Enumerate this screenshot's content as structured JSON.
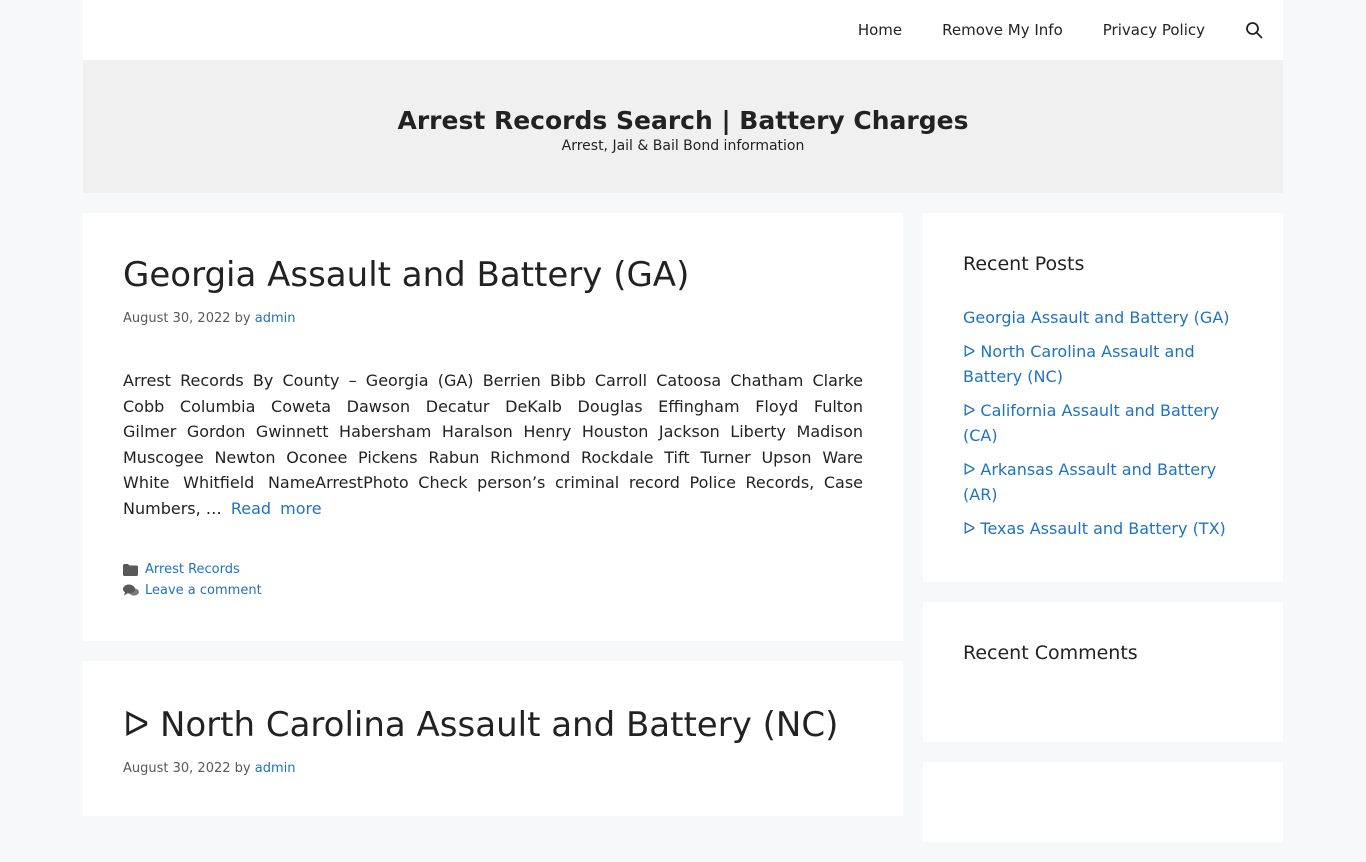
{
  "nav": {
    "items": [
      "Home",
      "Remove My Info",
      "Privacy Policy"
    ],
    "search_icon": "search-icon"
  },
  "header": {
    "title": "Arrest Records Search | Battery Charges",
    "description": "Arrest, Jail & Bail Bond information"
  },
  "posts": [
    {
      "title": "Georgia Assault and Battery (GA)",
      "date": "August 30, 2022",
      "by": "by",
      "author": "admin",
      "counties": "Arrest Records By County – Georgia (GA) Berrien Bibb Carroll Catoosa Chatham Clarke Cobb Columbia Coweta Dawson Decatur DeKalb Douglas Effingham Floyd Fulton Gilmer Gordon Gwinnett Habersham Haralson Henry Houston Jackson Liberty Madison Muscogee Newton Oconee Pickens Rabun Richmond Rockdale Tift Turner Upson Ware White Whitfield",
      "excerpt": "NameArrestPhoto Check person’s criminal record Police Records, Case Numbers, …",
      "read_more": "Read more",
      "category": "Arrest Records",
      "comment_link": "Leave a comment"
    },
    {
      "title": "ᐅ North Carolina Assault and Battery (NC)",
      "date": "August 30, 2022",
      "by": "by",
      "author": "admin"
    }
  ],
  "sidebar": {
    "recent_posts_title": "Recent Posts",
    "recent_posts": [
      "Georgia Assault and Battery (GA)",
      "ᐅ North Carolina Assault and Battery (NC)",
      "ᐅ California Assault and Battery (CA)",
      "ᐅ Arkansas Assault and Battery (AR)",
      "ᐅ Texas Assault and Battery (TX)"
    ],
    "recent_comments_title": "Recent Comments"
  },
  "colors": {
    "link": "#1e73be",
    "background": "#f7f8f9",
    "header": "#f0f0f0"
  }
}
